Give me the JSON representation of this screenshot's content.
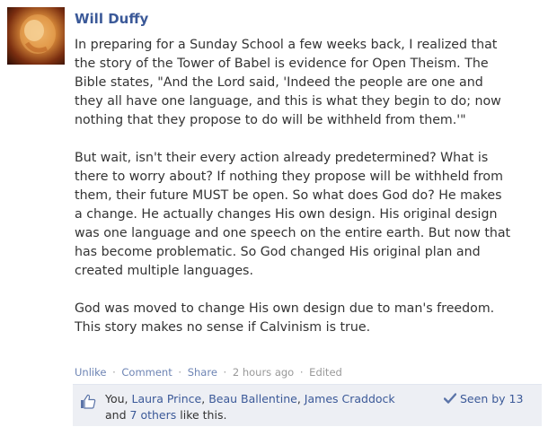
{
  "author": "Will Duffy",
  "post": {
    "paragraphs": [
      "In preparing for a Sunday School a few weeks back, I realized that\nthe story of the Tower of Babel is evidence for Open Theism. The\nBible states, \"And the Lord said, 'Indeed the people are one and\nthey all have one language, and this is what they begin to do; now\nnothing that they propose to do will be withheld from them.'\"",
      "But wait, isn't their every action already predetermined? What is\nthere to worry about? If nothing they propose will be withheld from\nthem, their future MUST be open. So what does God do? He makes\na change. He actually changes His own design. His original design\nwas one language and one speech on the entire earth. But now that\nhas become problematic. So God changed His original plan and\ncreated multiple languages.",
      "God was moved to change His own design due to man's freedom.\nThis story makes no sense if Calvinism is true."
    ]
  },
  "actions": {
    "unlike": "Unlike",
    "comment": "Comment",
    "share": "Share",
    "time": "2 hours ago",
    "edited": "Edited",
    "separator": "·"
  },
  "likes": {
    "you": "You,",
    "name1": "Laura Prince",
    "name2": "Beau Ballentine",
    "name3": "James Craddock",
    "and": "and",
    "others": "7 others",
    "tail": "like this.",
    "comma": ","
  },
  "seen": "Seen by 13",
  "icons": {
    "like": "thumbs-up-icon",
    "seen": "checkmark-icon"
  },
  "colors": {
    "link": "#3b5998",
    "action_link": "#6d84b4",
    "likes_bg": "#edeff4"
  }
}
